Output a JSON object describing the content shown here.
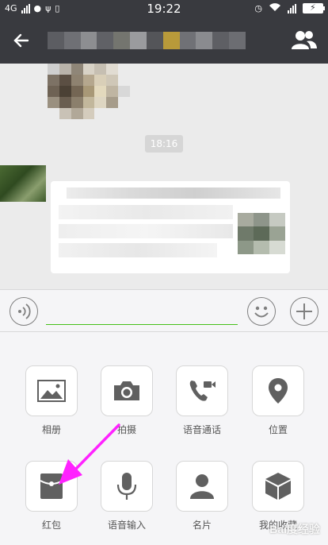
{
  "status_bar": {
    "network": "4G",
    "time": "19:22"
  },
  "chat": {
    "timestamp": "18:16"
  },
  "input": {
    "value": "",
    "placeholder": ""
  },
  "tools": [
    {
      "label": "相册",
      "icon": "photo-album-icon"
    },
    {
      "label": "拍摄",
      "icon": "camera-icon"
    },
    {
      "label": "语音通话",
      "icon": "video-call-icon"
    },
    {
      "label": "位置",
      "icon": "location-icon"
    },
    {
      "label": "红包",
      "icon": "red-packet-icon"
    },
    {
      "label": "语音输入",
      "icon": "microphone-icon"
    },
    {
      "label": "名片",
      "icon": "contact-card-icon"
    },
    {
      "label": "我的收藏",
      "icon": "favorites-icon"
    }
  ],
  "colors": {
    "header": "#393a3f",
    "accent_green": "#45c01a",
    "annotation_arrow": "#ff22ff"
  }
}
